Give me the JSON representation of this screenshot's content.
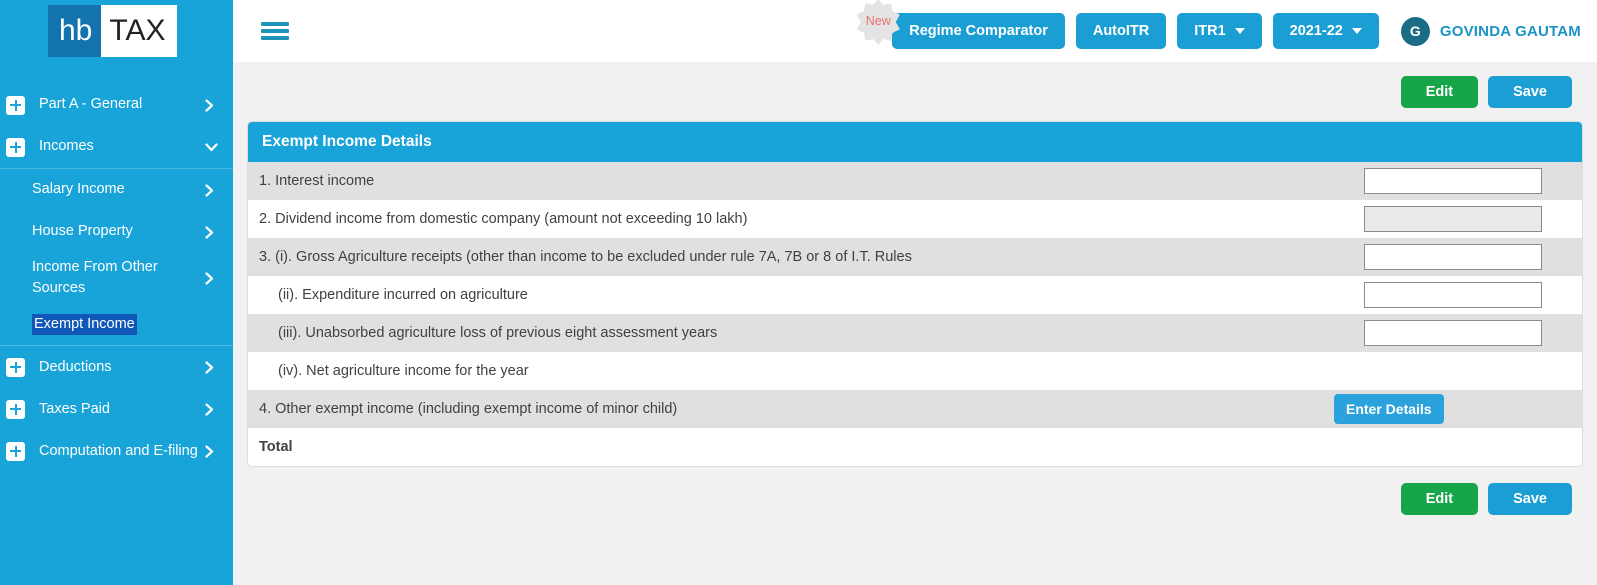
{
  "sidebar": {
    "logo": {
      "mark": "hb",
      "word": "TAX"
    },
    "items": [
      {
        "label": "Part A - General",
        "level": "top",
        "icon": "plus-box-icon",
        "chevron": "chevron-right-icon",
        "selected": false
      },
      {
        "label": "Incomes",
        "level": "top",
        "icon": "plus-box-icon",
        "chevron": "chevron-down-icon",
        "selected": false
      },
      {
        "label": "Salary Income",
        "level": "sub",
        "icon": null,
        "chevron": "chevron-right-icon",
        "selected": false
      },
      {
        "label": "House Property",
        "level": "sub",
        "icon": null,
        "chevron": "chevron-right-icon",
        "selected": false
      },
      {
        "label": "Income From Other Sources",
        "level": "sub",
        "icon": null,
        "chevron": "chevron-right-icon",
        "selected": false
      },
      {
        "label": "Exempt Income",
        "level": "sub",
        "icon": null,
        "chevron": null,
        "selected": true
      },
      {
        "label": "Deductions",
        "level": "top",
        "icon": "plus-box-icon",
        "chevron": "chevron-right-icon",
        "selected": false
      },
      {
        "label": "Taxes Paid",
        "level": "top",
        "icon": "plus-box-icon",
        "chevron": "chevron-right-icon",
        "selected": false
      },
      {
        "label": "Computation and E-filing",
        "level": "top",
        "icon": "plus-box-icon",
        "chevron": "chevron-right-icon",
        "selected": false
      }
    ]
  },
  "topbar": {
    "menu_icon": "hamburger-icon",
    "new_badge": "New",
    "regime_comparator": "Regime Comparator",
    "auto_itr": "AutoITR",
    "itr_form": "ITR1",
    "assessment_year": "2021-22",
    "user_initial": "G",
    "user_name": "GOVINDA GAUTAM"
  },
  "actions": {
    "edit_label": "Edit",
    "save_label": "Save"
  },
  "card": {
    "title": "Exempt Income Details",
    "rows": [
      {
        "label": "1. Interest income",
        "indent": false,
        "bold": false,
        "shaded": true,
        "control": "input",
        "value": "",
        "disabled": false
      },
      {
        "label": "2. Dividend income from domestic company (amount not exceeding 10 lakh)",
        "indent": false,
        "bold": false,
        "shaded": false,
        "control": "input",
        "value": "",
        "disabled": true
      },
      {
        "label": "3. (i). Gross Agriculture receipts (other than income to be excluded under rule 7A, 7B or 8 of I.T. Rules",
        "indent": false,
        "bold": false,
        "shaded": true,
        "control": "input",
        "value": "",
        "disabled": false
      },
      {
        "label": "(ii). Expenditure incurred on agriculture",
        "indent": true,
        "bold": false,
        "shaded": false,
        "control": "input",
        "value": "",
        "disabled": false
      },
      {
        "label": "(iii). Unabsorbed agriculture loss of previous eight assessment years",
        "indent": true,
        "bold": false,
        "shaded": true,
        "control": "input",
        "value": "",
        "disabled": false
      },
      {
        "label": "(iv). Net agriculture income for the year",
        "indent": true,
        "bold": false,
        "shaded": false,
        "control": "none",
        "value": "",
        "disabled": false
      },
      {
        "label": "4. Other exempt income (including exempt income of minor child)",
        "indent": false,
        "bold": false,
        "shaded": true,
        "control": "button",
        "button_label": "Enter Details",
        "value": "",
        "disabled": false
      },
      {
        "label": "Total",
        "indent": false,
        "bold": true,
        "shaded": false,
        "control": "none",
        "value": "",
        "disabled": false
      }
    ]
  },
  "colors": {
    "brand_blue": "#18a4d8",
    "logo_blue": "#1273ae",
    "edit_green": "#17a54a",
    "save_blue": "#1a9ed4",
    "selected_nav": "#1057b8",
    "badge_red": "#e8736c",
    "avatar_teal": "#1b6d86",
    "row_shaded": "#e0e0e0",
    "page_bg": "#f1f1f1"
  }
}
